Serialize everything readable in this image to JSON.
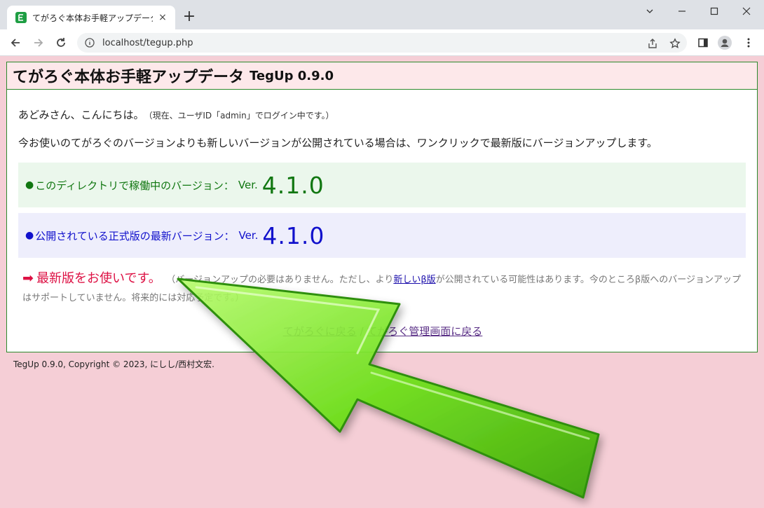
{
  "browser": {
    "tab_title": "てがろぐ本体お手軽アップデータ TegUp",
    "tab_close": "×",
    "new_tab": "+",
    "url": "localhost/tegup.php",
    "favicon_glyph": "𝓔"
  },
  "page": {
    "title": "てがろぐ本体お手軽アップデータ",
    "subtitle": "TegUp 0.9.0",
    "greeting": "あどみさん、こんにちは。",
    "greeting_note": "（現在、ユーザID「admin」でログイン中です。）",
    "intro": "今お使いのてがろぐのバージョンよりも新しいバージョンが公開されている場合は、ワンクリックで最新版にバージョンアップします。",
    "current": {
      "dot": "●",
      "label": "このディレクトリで稼働中のバージョン：",
      "ver_prefix": "Ver.",
      "version": "4.1.0"
    },
    "latest": {
      "dot": "●",
      "label": "公開されている正式版の最新バージョン：",
      "ver_prefix": "Ver.",
      "version": "4.1.0"
    },
    "status": {
      "arrow": "➡",
      "main": "最新版をお使いです。",
      "note_before": "（バージョンアップの必要はありません。ただし、より",
      "beta_link": "新しいβ版",
      "note_after": "が公開されている可能性はあります。今のところβ版へのバージョンアップはサポートしていません。将来的には対応予定です。）"
    },
    "links": {
      "back_tegalog": "てがろぐに戻る",
      "separator": " / ",
      "back_admin": "てがろぐ管理画面に戻る"
    },
    "footer": "TegUp 0.9.0, Copyright © 2023, にしし/西村文宏."
  },
  "colors": {
    "background": "#f5ced6",
    "header_bg": "#fde8ea",
    "border": "#2d8a2d",
    "current_version": "#117711",
    "latest_version": "#1111cc",
    "status_red": "#dd1144",
    "overlay_arrow": "#6ee21a"
  }
}
